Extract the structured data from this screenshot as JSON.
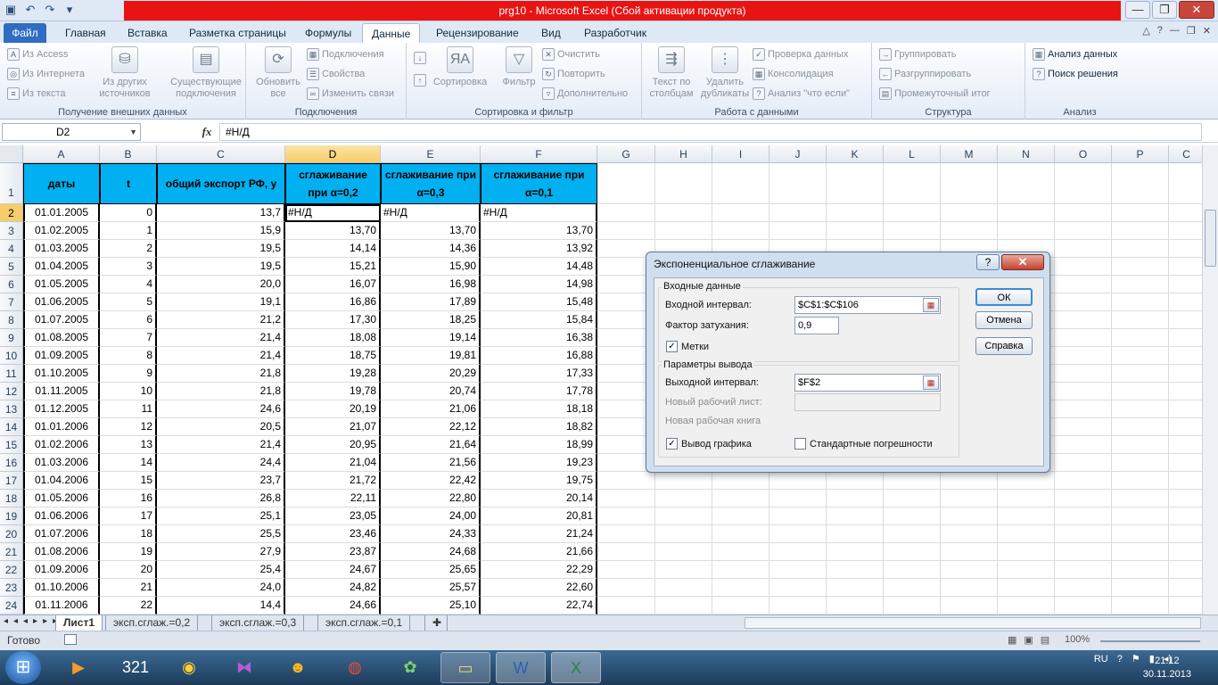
{
  "window": {
    "title": "prg10  -  Microsoft Excel (Сбой активации продукта)"
  },
  "qat": [
    "save-icon",
    "undo-icon",
    "redo-icon",
    "customize-icon"
  ],
  "tabs": [
    {
      "label": "Файл"
    },
    {
      "label": "Главная"
    },
    {
      "label": "Вставка"
    },
    {
      "label": "Разметка страницы"
    },
    {
      "label": "Формулы"
    },
    {
      "label": "Данные"
    },
    {
      "label": "Рецензирование"
    },
    {
      "label": "Вид"
    },
    {
      "label": "Разработчик"
    }
  ],
  "ribbon": {
    "g1": {
      "label": "Получение внешних данных",
      "items": [
        "Из Access",
        "Из Интернета",
        "Из текста"
      ],
      "big": "Из других источников",
      "big2": "Существующие подключения"
    },
    "g2": {
      "label": "Подключения",
      "big": "Обновить все",
      "items": [
        "Подключения",
        "Свойства",
        "Изменить связи"
      ]
    },
    "g3": {
      "label": "Сортировка и фильтр",
      "sort": "Сортировка",
      "filter": "Фильтр",
      "items": [
        "Очистить",
        "Повторить",
        "Дополнительно"
      ]
    },
    "g4": {
      "label": "Работа с данными",
      "b1": "Текст по столбцам",
      "b2": "Удалить дубликаты",
      "items": [
        "Проверка данных",
        "Консолидация",
        "Анализ \"что если\""
      ]
    },
    "g5": {
      "label": "Структура",
      "items": [
        "Группировать",
        "Разгруппировать",
        "Промежуточный итог"
      ]
    },
    "g6": {
      "label": "Анализ",
      "items": [
        "Анализ данных",
        "Поиск решения"
      ]
    }
  },
  "formula": {
    "namebox": "D2",
    "fx": "fx",
    "value": "#Н/Д"
  },
  "columns": [
    "A",
    "B",
    "C",
    "D",
    "E",
    "F",
    "G",
    "H",
    "I",
    "J",
    "K",
    "L",
    "M",
    "N",
    "O",
    "P",
    "C"
  ],
  "header_row": {
    "a": "даты",
    "b": "t",
    "c": "общий экспорт РФ, у",
    "d": "сглаживание при α=0,2",
    "e": "сглаживание при α=0,3",
    "f": "сглаживание при α=0,1"
  },
  "rows": [
    {
      "n": "2",
      "a": "01.01.2005",
      "b": "0",
      "c": "13,7",
      "d": "#Н/Д",
      "e": "#Н/Д",
      "f": "#Н/Д"
    },
    {
      "n": "3",
      "a": "01.02.2005",
      "b": "1",
      "c": "15,9",
      "d": "13,70",
      "e": "13,70",
      "f": "13,70"
    },
    {
      "n": "4",
      "a": "01.03.2005",
      "b": "2",
      "c": "19,5",
      "d": "14,14",
      "e": "14,36",
      "f": "13,92"
    },
    {
      "n": "5",
      "a": "01.04.2005",
      "b": "3",
      "c": "19,5",
      "d": "15,21",
      "e": "15,90",
      "f": "14,48"
    },
    {
      "n": "6",
      "a": "01.05.2005",
      "b": "4",
      "c": "20,0",
      "d": "16,07",
      "e": "16,98",
      "f": "14,98"
    },
    {
      "n": "7",
      "a": "01.06.2005",
      "b": "5",
      "c": "19,1",
      "d": "16,86",
      "e": "17,89",
      "f": "15,48"
    },
    {
      "n": "8",
      "a": "01.07.2005",
      "b": "6",
      "c": "21,2",
      "d": "17,30",
      "e": "18,25",
      "f": "15,84"
    },
    {
      "n": "9",
      "a": "01.08.2005",
      "b": "7",
      "c": "21,4",
      "d": "18,08",
      "e": "19,14",
      "f": "16,38"
    },
    {
      "n": "10",
      "a": "01.09.2005",
      "b": "8",
      "c": "21,4",
      "d": "18,75",
      "e": "19,81",
      "f": "16,88"
    },
    {
      "n": "11",
      "a": "01.10.2005",
      "b": "9",
      "c": "21,8",
      "d": "19,28",
      "e": "20,29",
      "f": "17,33"
    },
    {
      "n": "12",
      "a": "01.11.2005",
      "b": "10",
      "c": "21,8",
      "d": "19,78",
      "e": "20,74",
      "f": "17,78"
    },
    {
      "n": "13",
      "a": "01.12.2005",
      "b": "11",
      "c": "24,6",
      "d": "20,19",
      "e": "21,06",
      "f": "18,18"
    },
    {
      "n": "14",
      "a": "01.01.2006",
      "b": "12",
      "c": "20,5",
      "d": "21,07",
      "e": "22,12",
      "f": "18,82"
    },
    {
      "n": "15",
      "a": "01.02.2006",
      "b": "13",
      "c": "21,4",
      "d": "20,95",
      "e": "21,64",
      "f": "18,99"
    },
    {
      "n": "16",
      "a": "01.03.2006",
      "b": "14",
      "c": "24,4",
      "d": "21,04",
      "e": "21,56",
      "f": "19,23"
    },
    {
      "n": "17",
      "a": "01.04.2006",
      "b": "15",
      "c": "23,7",
      "d": "21,72",
      "e": "22,42",
      "f": "19,75"
    },
    {
      "n": "18",
      "a": "01.05.2006",
      "b": "16",
      "c": "26,8",
      "d": "22,11",
      "e": "22,80",
      "f": "20,14"
    },
    {
      "n": "19",
      "a": "01.06.2006",
      "b": "17",
      "c": "25,1",
      "d": "23,05",
      "e": "24,00",
      "f": "20,81"
    },
    {
      "n": "20",
      "a": "01.07.2006",
      "b": "18",
      "c": "25,5",
      "d": "23,46",
      "e": "24,33",
      "f": "21,24"
    },
    {
      "n": "21",
      "a": "01.08.2006",
      "b": "19",
      "c": "27,9",
      "d": "23,87",
      "e": "24,68",
      "f": "21,66"
    },
    {
      "n": "22",
      "a": "01.09.2006",
      "b": "20",
      "c": "25,4",
      "d": "24,67",
      "e": "25,65",
      "f": "22,29"
    },
    {
      "n": "23",
      "a": "01.10.2006",
      "b": "21",
      "c": "24,0",
      "d": "24,82",
      "e": "25,57",
      "f": "22,60"
    },
    {
      "n": "24",
      "a": "01.11.2006",
      "b": "22",
      "c": "14,4",
      "d": "24,66",
      "e": "25,10",
      "f": "22,74"
    }
  ],
  "sheets": [
    "Лист1",
    "эксп.сглаж.=0,2",
    "эксп.сглаж.=0,3",
    "эксп.сглаж.=0,1"
  ],
  "status": {
    "ready": "Готово",
    "zoom": "100%"
  },
  "dialog": {
    "title": "Экспоненциальное сглаживание",
    "help": "?",
    "input_group": "Входные данные",
    "input_range_label": "Входной интервал:",
    "input_range": "$C$1:$C$106",
    "damping_label": "Фактор затухания:",
    "damping": "0,9",
    "labels_chk": "Метки",
    "output_group": "Параметры вывода",
    "output_range_label": "Выходной интервал:",
    "output_range": "$F$2",
    "new_sheet_label": "Новый рабочий лист:",
    "new_book_label": "Новая рабочая книга",
    "chart_chk": "Вывод графика",
    "stderr_chk": "Стандартные погрешности",
    "ok": "ОК",
    "cancel": "Отмена",
    "helpbtn": "Справка"
  },
  "taskbar": {
    "lang": "RU",
    "time": "21:12",
    "date": "30.11.2013"
  }
}
